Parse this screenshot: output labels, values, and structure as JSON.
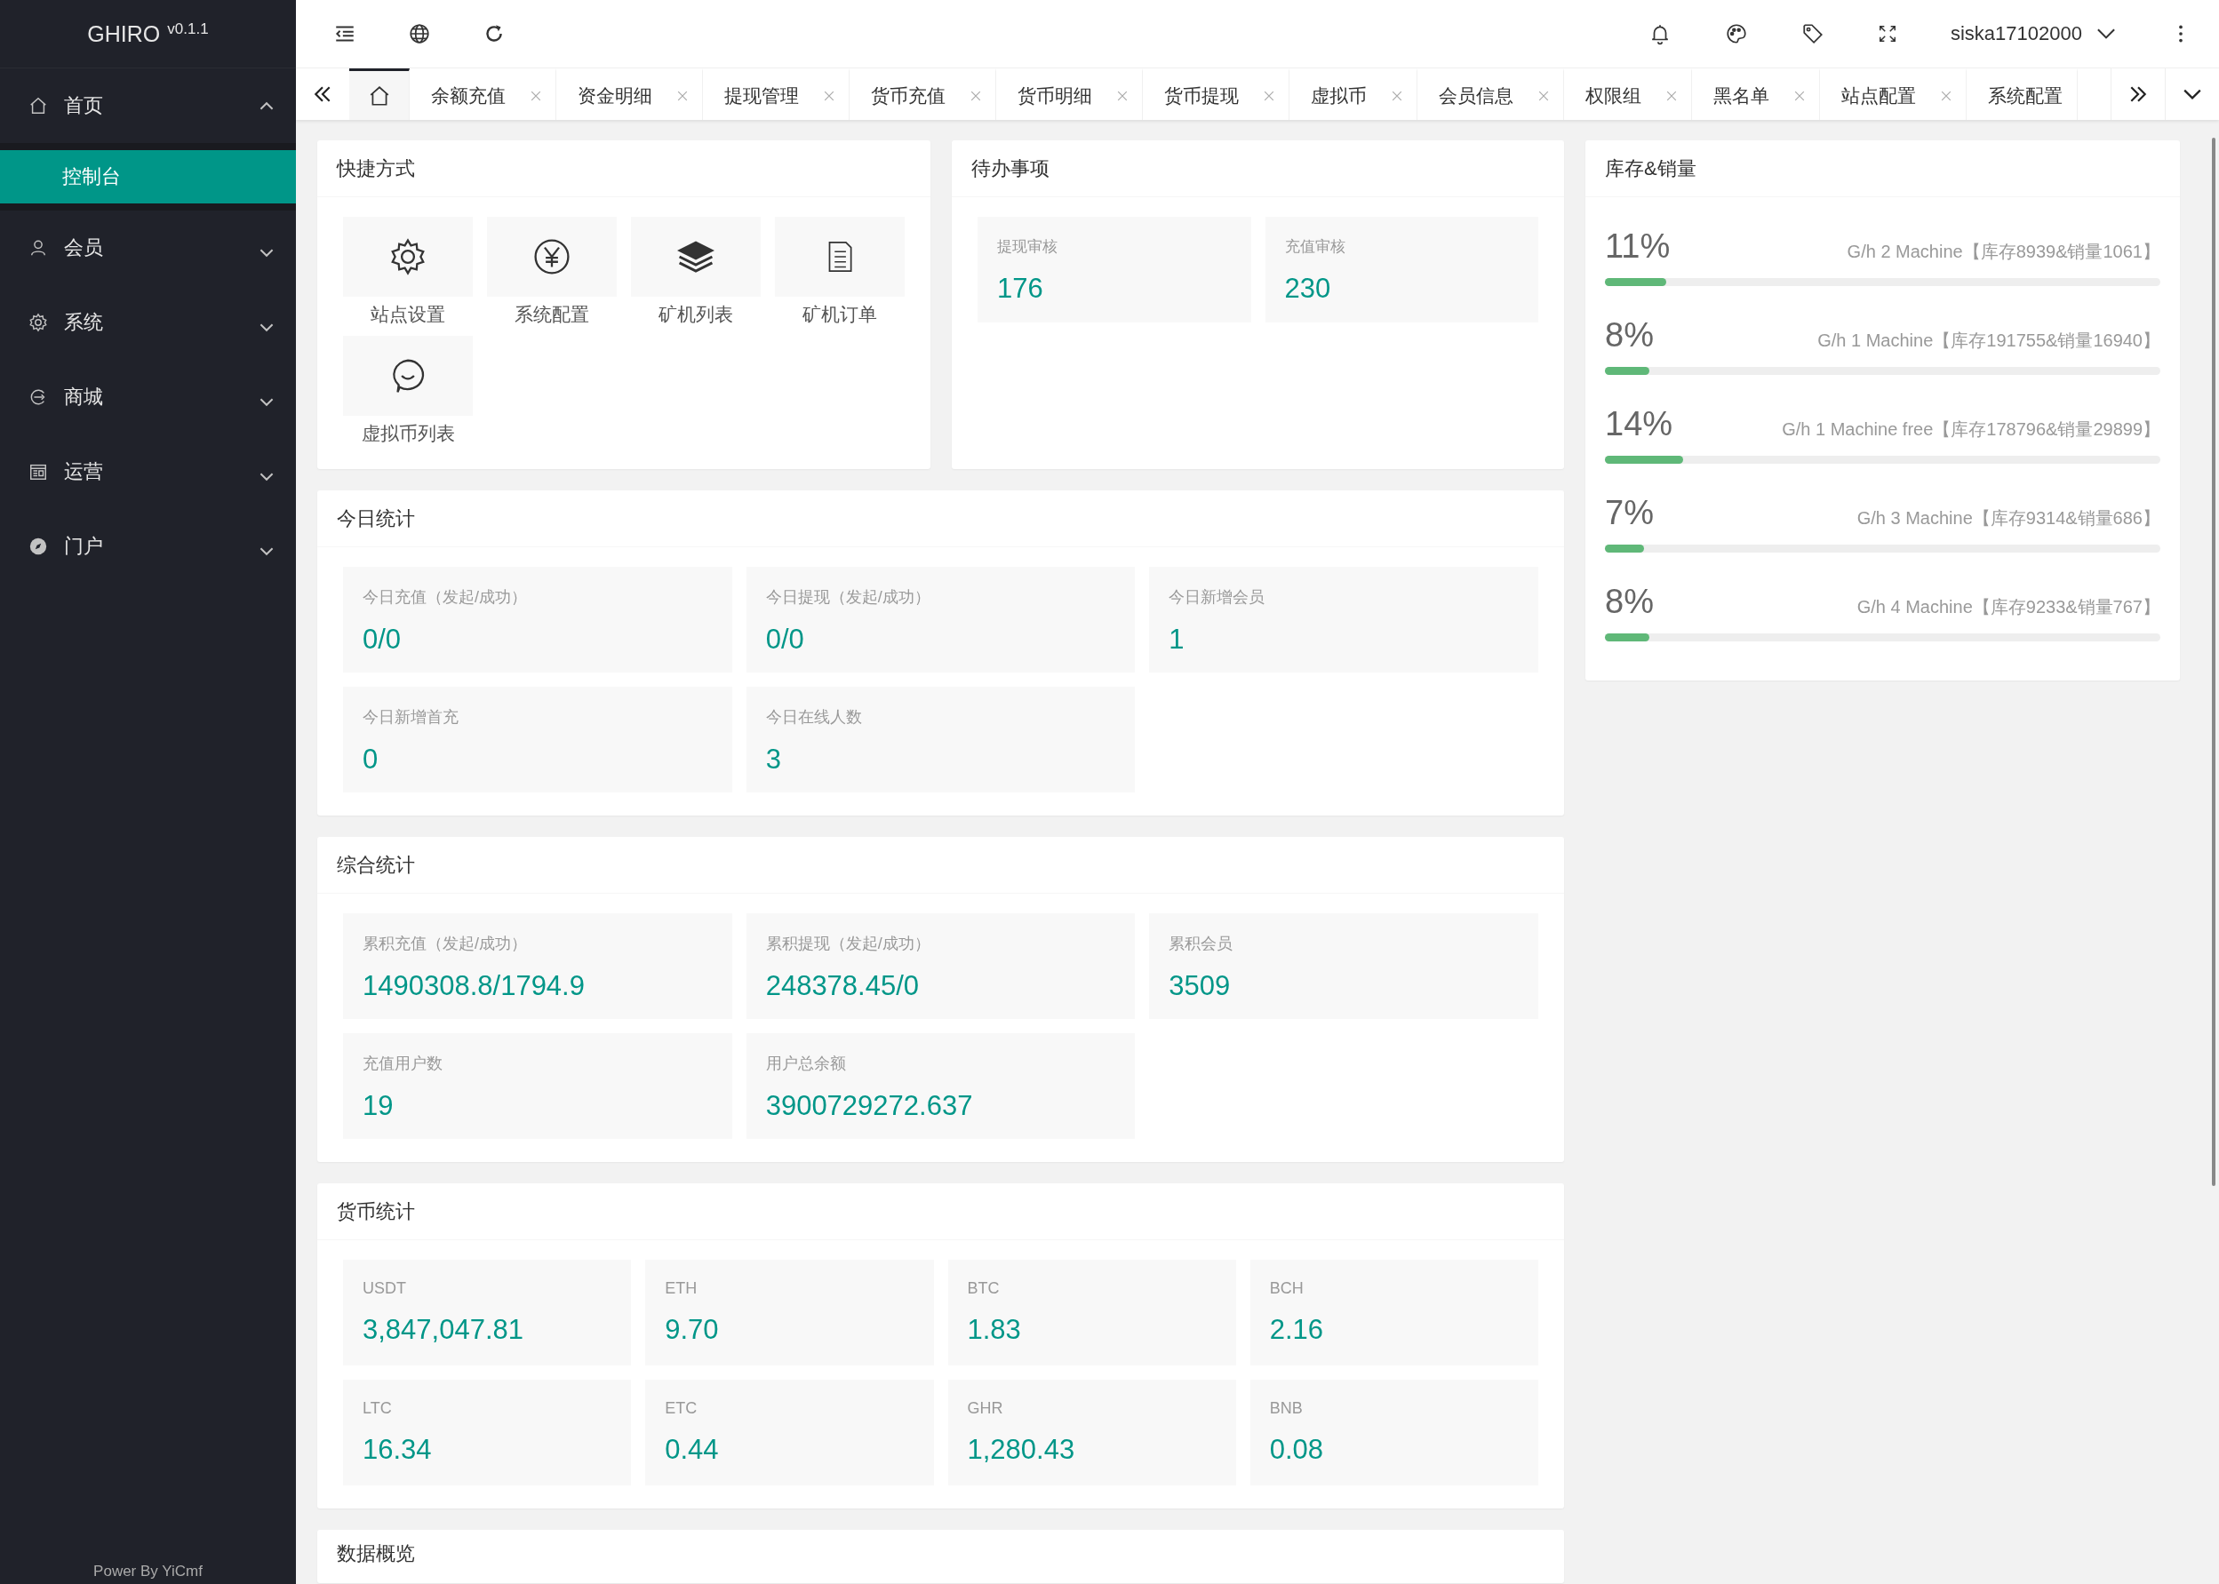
{
  "sidebar": {
    "logo": "GHIRO",
    "version": "v0.1.1",
    "menu": [
      {
        "kind": "home",
        "label": "首页",
        "expanded": true,
        "children": [
          {
            "label": "控制台",
            "selected": true
          }
        ]
      },
      {
        "kind": "user",
        "label": "会员",
        "expanded": false
      },
      {
        "kind": "gear",
        "label": "系统",
        "expanded": false
      },
      {
        "kind": "shop",
        "label": "商城",
        "expanded": false
      },
      {
        "kind": "calendar",
        "label": "运营",
        "expanded": false
      },
      {
        "kind": "compass",
        "label": "门户",
        "expanded": false
      }
    ],
    "footer": "Power By YiCmf"
  },
  "header": {
    "user": "siska17102000"
  },
  "tabs": [
    {
      "kind": "home",
      "selected": true
    },
    {
      "kind": "page",
      "label": "余额充值",
      "selected": false,
      "closable": true
    },
    {
      "kind": "page",
      "label": "资金明细",
      "selected": false,
      "closable": true
    },
    {
      "kind": "page",
      "label": "提现管理",
      "selected": false,
      "closable": true
    },
    {
      "kind": "page",
      "label": "货币充值",
      "selected": false,
      "closable": true
    },
    {
      "kind": "page",
      "label": "货币明细",
      "selected": false,
      "closable": true
    },
    {
      "kind": "page",
      "label": "货币提现",
      "selected": false,
      "closable": true
    },
    {
      "kind": "page",
      "label": "虚拟币",
      "selected": false,
      "closable": true
    },
    {
      "kind": "page",
      "label": "会员信息",
      "selected": false,
      "closable": true
    },
    {
      "kind": "page",
      "label": "权限组",
      "selected": false,
      "closable": true
    },
    {
      "kind": "page",
      "label": "黑名单",
      "selected": false,
      "closable": true
    },
    {
      "kind": "page",
      "label": "站点配置",
      "selected": false,
      "closable": true
    },
    {
      "kind": "page",
      "label": "系统配置",
      "selected": false,
      "closable": false
    }
  ],
  "shortcuts": {
    "title": "快捷方式",
    "items": [
      {
        "kind": "gear",
        "label": "站点设置"
      },
      {
        "kind": "yen",
        "label": "系统配置"
      },
      {
        "kind": "layers",
        "label": "矿机列表"
      },
      {
        "kind": "document",
        "label": "矿机订单"
      },
      {
        "kind": "chat",
        "label": "虚拟币列表"
      }
    ]
  },
  "todo": {
    "title": "待办事项",
    "items": [
      {
        "label": "提现审核",
        "value": "176"
      },
      {
        "label": "充值审核",
        "value": "230"
      }
    ]
  },
  "today": {
    "title": "今日统计",
    "items": [
      {
        "label": "今日充值（发起/成功）",
        "value": "0/0"
      },
      {
        "label": "今日提现（发起/成功）",
        "value": "0/0"
      },
      {
        "label": "今日新增会员",
        "value": "1"
      },
      {
        "label": "今日新增首充",
        "value": "0"
      },
      {
        "label": "今日在线人数",
        "value": "3"
      }
    ]
  },
  "overall": {
    "title": "综合统计",
    "items": [
      {
        "label": "累积充值（发起/成功）",
        "value": "1490308.8/1794.9"
      },
      {
        "label": "累积提现（发起/成功）",
        "value": "248378.45/0"
      },
      {
        "label": "累积会员",
        "value": "3509"
      },
      {
        "label": "充值用户数",
        "value": "19"
      },
      {
        "label": "用户总余额",
        "value": "3900729272.637"
      }
    ]
  },
  "currencies": {
    "title": "货币统计",
    "items": [
      {
        "label": "USDT",
        "value": "3,847,047.81"
      },
      {
        "label": "ETH",
        "value": "9.70"
      },
      {
        "label": "BTC",
        "value": "1.83"
      },
      {
        "label": "BCH",
        "value": "2.16"
      },
      {
        "label": "LTC",
        "value": "16.34"
      },
      {
        "label": "ETC",
        "value": "0.44"
      },
      {
        "label": "GHR",
        "value": "1,280.43"
      },
      {
        "label": "BNB",
        "value": "0.08"
      }
    ]
  },
  "overview": {
    "title": "数据概览"
  },
  "inventory": {
    "title": "库存&销量",
    "items": [
      {
        "percent": "11%",
        "label": "G/h 2 Machine【库存8939&销量1061】",
        "level": 0.11
      },
      {
        "percent": "8%",
        "label": "G/h 1 Machine【库存191755&销量16940】",
        "level": 0.08
      },
      {
        "percent": "14%",
        "label": "G/h 1 Machine free【库存178796&销量29899】",
        "level": 0.14
      },
      {
        "percent": "7%",
        "label": "G/h 3 Machine【库存9314&销量686】",
        "level": 0.07
      },
      {
        "percent": "8%",
        "label": "G/h 4 Machine【库存9233&销量767】",
        "level": 0.08
      }
    ]
  }
}
